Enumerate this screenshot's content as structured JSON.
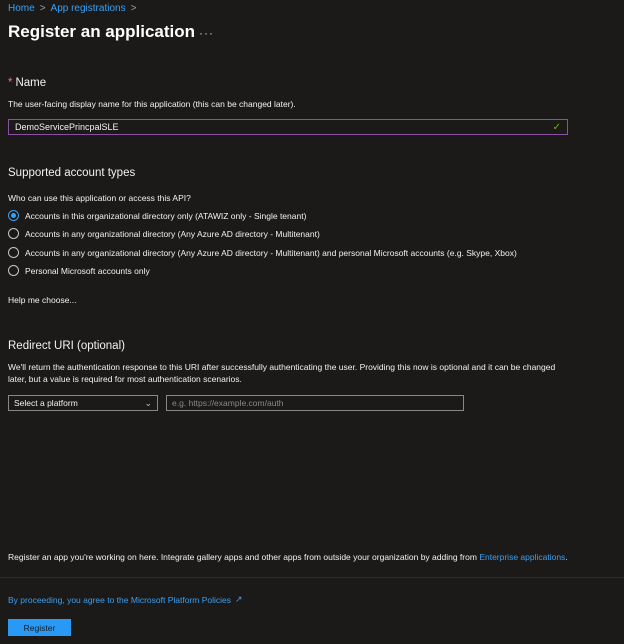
{
  "breadcrumb": {
    "home": "Home",
    "app_registrations": "App registrations",
    "separator": ">"
  },
  "header": {
    "title": "Register an application",
    "more_label": "···"
  },
  "name_section": {
    "required_marker": "*",
    "label": "Name",
    "description": "The user-facing display name for this application (this can be changed later).",
    "value": "DemoServicePrincpalSLE",
    "valid_icon": "checkmark-icon"
  },
  "account_types": {
    "heading": "Supported account types",
    "question": "Who can use this application or access this API?",
    "options": [
      {
        "label": "Accounts in this organizational directory only (ATAWIZ only - Single tenant)",
        "checked": true
      },
      {
        "label": "Accounts in any organizational directory (Any Azure AD directory - Multitenant)",
        "checked": false
      },
      {
        "label": "Accounts in any organizational directory (Any Azure AD directory - Multitenant) and personal Microsoft accounts (e.g. Skype, Xbox)",
        "checked": false
      },
      {
        "label": "Personal Microsoft accounts only",
        "checked": false
      }
    ],
    "help_link": "Help me choose..."
  },
  "redirect": {
    "heading": "Redirect URI (optional)",
    "description": "We'll return the authentication response to this URI after successfully authenticating the user. Providing this now is optional and it can be changed later, but a value is required for most authentication scenarios.",
    "platform_selected": "Select a platform",
    "uri_placeholder": "e.g. https://example.com/auth"
  },
  "footer": {
    "note_text": "Register an app you're working on here. Integrate gallery apps and other apps from outside your organization by adding from",
    "note_link": "Enterprise applications",
    "note_end": ".",
    "policy_text": "By proceeding, you agree to the Microsoft Platform Policies",
    "external_icon": "external-link-icon",
    "register_label": "Register"
  },
  "colors": {
    "background": "#1b1a19",
    "accent": "#2899f5",
    "link": "#3aa0f3",
    "focus_border": "#8b4fa6",
    "required": "#f1707b",
    "valid": "#6bb700"
  }
}
